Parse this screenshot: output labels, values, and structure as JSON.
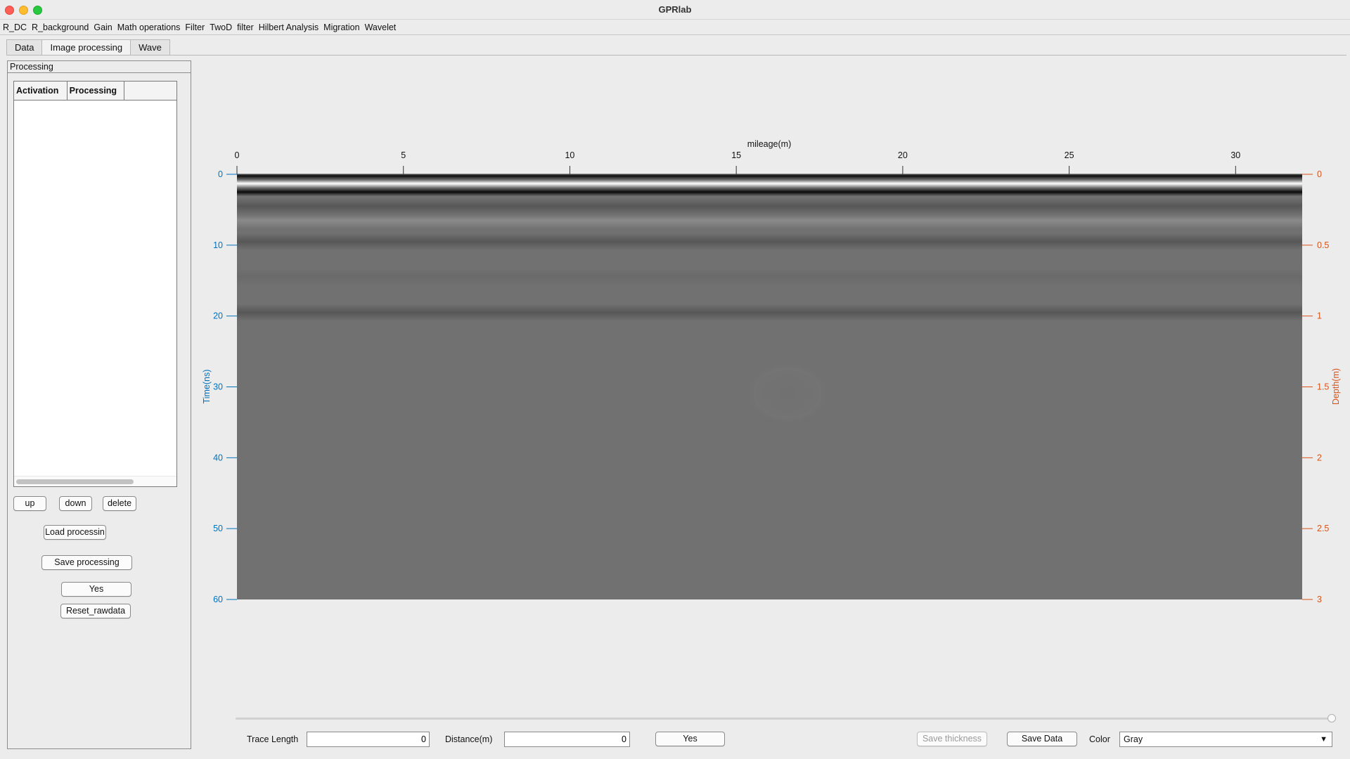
{
  "window": {
    "title": "GPRlab"
  },
  "menubar": [
    "R_DC",
    "R_background",
    "Gain",
    "Math operations",
    "Filter",
    "TwoD  filter",
    "Hilbert Analysis",
    "Migration",
    "Wavelet"
  ],
  "tabs": [
    {
      "label": "Data",
      "active": false
    },
    {
      "label": "Image processing",
      "active": true
    },
    {
      "label": "Wave",
      "active": false
    }
  ],
  "side_panel": {
    "title": "Processing",
    "table": {
      "columns": [
        "Activation",
        "Processing",
        ""
      ],
      "rows": []
    },
    "buttons": {
      "up": "up",
      "down": "down",
      "delete": "delete",
      "load": "Load processin",
      "save": "Save processing",
      "yes": "Yes",
      "reset": "Reset_rawdata"
    }
  },
  "bottom_bar": {
    "trace_length_label": "Trace Length",
    "trace_length_value": "0",
    "distance_label": "Distance(m)",
    "distance_value": "0",
    "yes_button": "Yes",
    "save_thickness_button": "Save thickness",
    "save_data_button": "Save Data",
    "color_label": "Color",
    "color_value": "Gray"
  },
  "chart_data": {
    "type": "heatmap",
    "title": "",
    "colormap": "gray",
    "x_axis": {
      "label": "mileage(m)",
      "position": "top",
      "range": [
        0,
        32
      ],
      "ticks": [
        0,
        5,
        10,
        15,
        20,
        25,
        30
      ]
    },
    "y_axis_left": {
      "label": "Time(ns)",
      "color": "#0072bd",
      "range": [
        0,
        60
      ],
      "reversed": true,
      "ticks": [
        0,
        10,
        20,
        30,
        40,
        50,
        60
      ]
    },
    "y_axis_right": {
      "label": "Depth(m)",
      "color": "#d95319",
      "range": [
        0,
        3
      ],
      "reversed": true,
      "ticks": [
        "0",
        "0.5",
        "1",
        "1.5",
        "2",
        "2.5",
        "3"
      ]
    },
    "reflection_bands": [
      {
        "time_ns": 0.2,
        "intensity": "black"
      },
      {
        "time_ns": 1.3,
        "intensity": "white"
      },
      {
        "time_ns": 2.5,
        "intensity": "black"
      },
      {
        "time_ns": 4.5,
        "intensity": "dark"
      },
      {
        "time_ns": 6.5,
        "intensity": "light"
      },
      {
        "time_ns": 9.5,
        "intensity": "dark"
      },
      {
        "time_ns": 14.5,
        "intensity": "faint"
      },
      {
        "time_ns": 19.5,
        "intensity": "dark"
      }
    ],
    "background_gray": "#717171"
  }
}
